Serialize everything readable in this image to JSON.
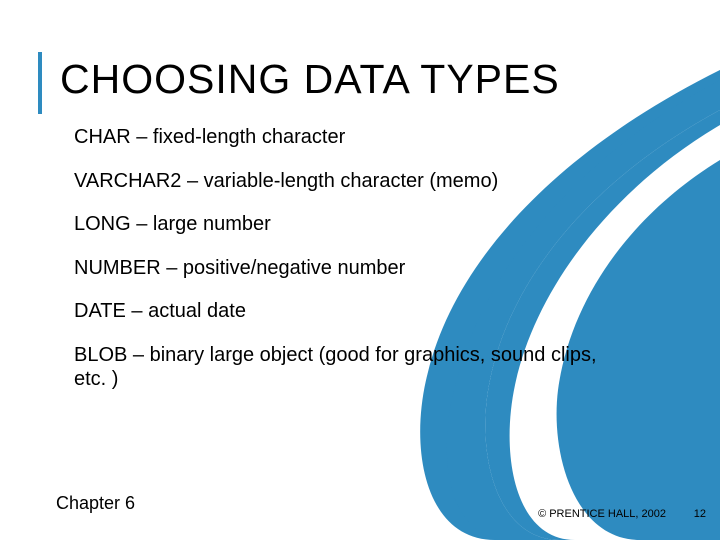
{
  "title": "CHOOSING DATA TYPES",
  "items": [
    "CHAR – fixed-length character",
    "VARCHAR2 – variable-length character (memo)",
    "LONG – large number",
    "NUMBER – positive/negative number",
    "DATE – actual date",
    "BLOB – binary large object (good for graphics, sound clips, etc. )"
  ],
  "chapter": "Chapter 6",
  "copyright": "© PRENTICE HALL, 2002",
  "page_number": "12",
  "accent_color": "#2e8bc0"
}
